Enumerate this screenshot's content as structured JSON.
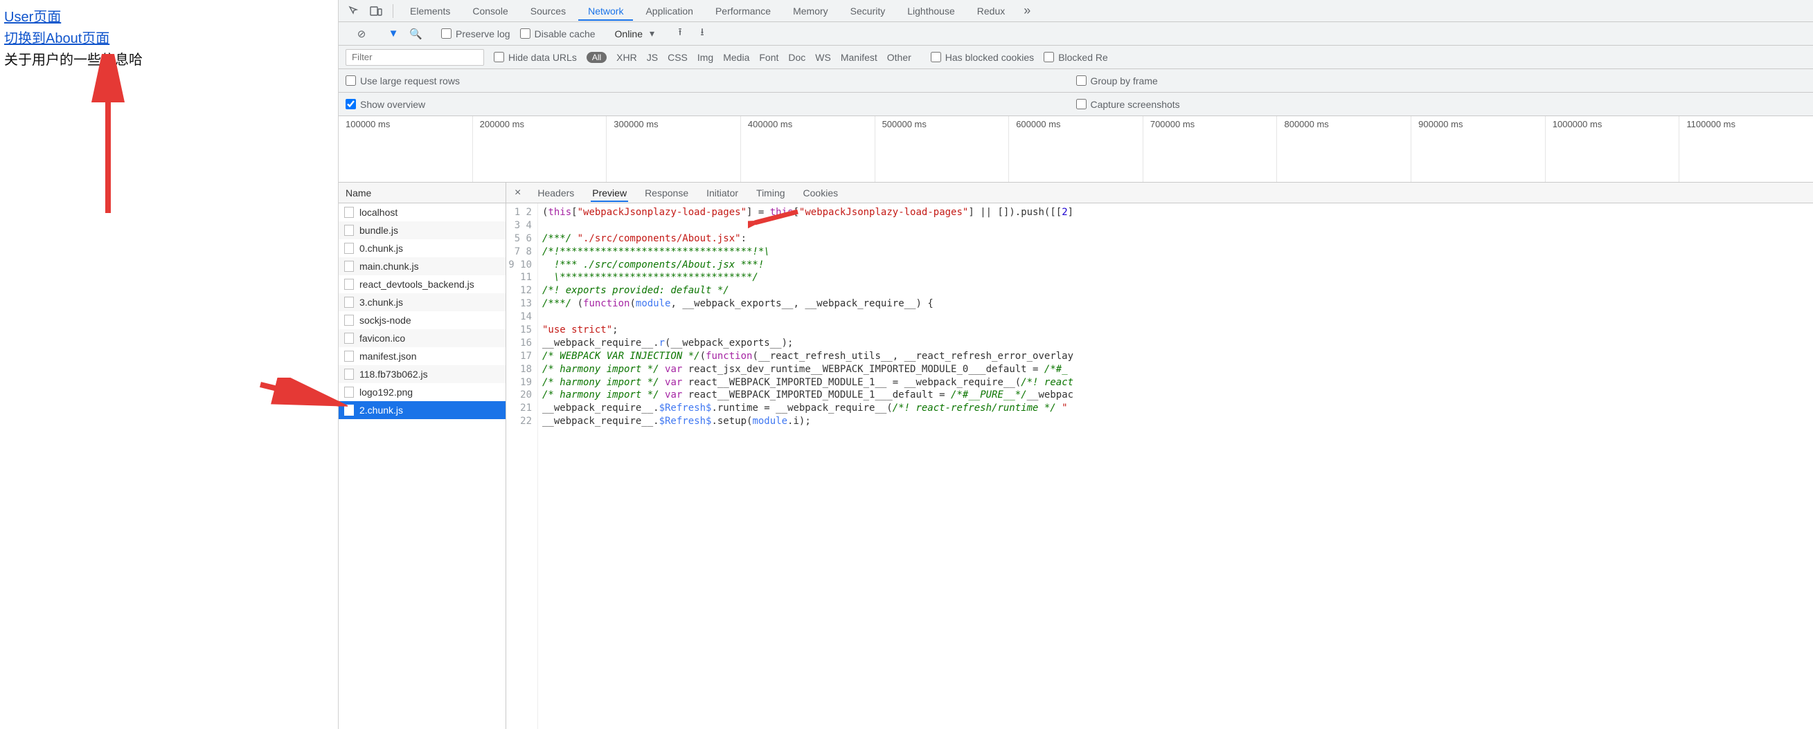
{
  "page": {
    "link1": "User页面",
    "link2": "切换到About页面",
    "info": "关于用户的一些信息哈"
  },
  "tabs": {
    "items": [
      "Elements",
      "Console",
      "Sources",
      "Network",
      "Application",
      "Performance",
      "Memory",
      "Security",
      "Lighthouse",
      "Redux"
    ],
    "active": "Network"
  },
  "toolbar": {
    "preserve_log": "Preserve log",
    "disable_cache": "Disable cache",
    "throttle": "Online"
  },
  "filter": {
    "placeholder": "Filter",
    "hide_data_urls": "Hide data URLs",
    "all": "All",
    "types": [
      "XHR",
      "JS",
      "CSS",
      "Img",
      "Media",
      "Font",
      "Doc",
      "WS",
      "Manifest",
      "Other"
    ],
    "has_blocked_cookies": "Has blocked cookies",
    "blocked_re": "Blocked Re"
  },
  "opts": {
    "use_large": "Use large request rows",
    "group_by_frame": "Group by frame",
    "show_overview": "Show overview",
    "capture_screenshots": "Capture screenshots"
  },
  "timeline": [
    "100000 ms",
    "200000 ms",
    "300000 ms",
    "400000 ms",
    "500000 ms",
    "600000 ms",
    "700000 ms",
    "800000 ms",
    "900000 ms",
    "1000000 ms",
    "1100000 ms"
  ],
  "requests": {
    "header": "Name",
    "items": [
      "localhost",
      "bundle.js",
      "0.chunk.js",
      "main.chunk.js",
      "react_devtools_backend.js",
      "3.chunk.js",
      "sockjs-node",
      "favicon.ico",
      "manifest.json",
      "118.fb73b062.js",
      "logo192.png",
      "2.chunk.js"
    ],
    "selected": "2.chunk.js"
  },
  "detail": {
    "tabs": [
      "Headers",
      "Preview",
      "Response",
      "Initiator",
      "Timing",
      "Cookies"
    ],
    "active": "Preview",
    "line_count": 22,
    "code": {
      "l1a": "(",
      "l1b": "this",
      "l1c": "[",
      "l1d": "\"webpackJsonplazy-load-pages\"",
      "l1e": "] = ",
      "l1f": "this",
      "l1g": "[",
      "l1h": "\"webpackJsonplazy-load-pages\"",
      "l1i": "] || []).push([[",
      "l1j": "2",
      "l1k": "]",
      "l3a": "/***/ ",
      "l3b": "\"./src/components/About.jsx\"",
      "l3c": ":",
      "l4": "/*!*********************************!*\\",
      "l5": "  !*** ./src/components/About.jsx ***!",
      "l6": "  \\*********************************/",
      "l7": "/*! exports provided: default */",
      "l8a": "/***/ ",
      "l8b": "(",
      "l8c": "function",
      "l8d": "(",
      "l8e": "module",
      "l8f": ", __webpack_exports__, __webpack_require__) {",
      "l10": "\"use strict\"",
      "l10b": ";",
      "l11a": "__webpack_require__.",
      "l11b": "r",
      "l11c": "(__webpack_exports__);",
      "l12a": "/* WEBPACK VAR INJECTION */",
      "l12b": "(",
      "l12c": "function",
      "l12d": "(__react_refresh_utils__, __react_refresh_error_overlay",
      "l13a": "/* harmony import */ ",
      "l13b": "var",
      "l13c": " react_jsx_dev_runtime__WEBPACK_IMPORTED_MODULE_0___default = ",
      "l13d": "/*#_",
      "l14a": "/* harmony import */ ",
      "l14b": "var",
      "l14c": " react__WEBPACK_IMPORTED_MODULE_1__ = __webpack_require__(",
      "l14d": "/*! react",
      "l15a": "/* harmony import */ ",
      "l15b": "var",
      "l15c": " react__WEBPACK_IMPORTED_MODULE_1___default = ",
      "l15d": "/*#__PURE__*/",
      "l15e": "__webpac",
      "l16a": "__webpack_require__.",
      "l16b": "$Refresh$",
      "l16c": ".runtime = __webpack_require__(",
      "l16d": "/*! react-refresh/runtime */ ",
      "l16e": "\"",
      "l17a": "__webpack_require__.",
      "l17b": "$Refresh$",
      "l17c": ".setup(",
      "l17d": "module",
      "l17e": ".i);"
    }
  }
}
